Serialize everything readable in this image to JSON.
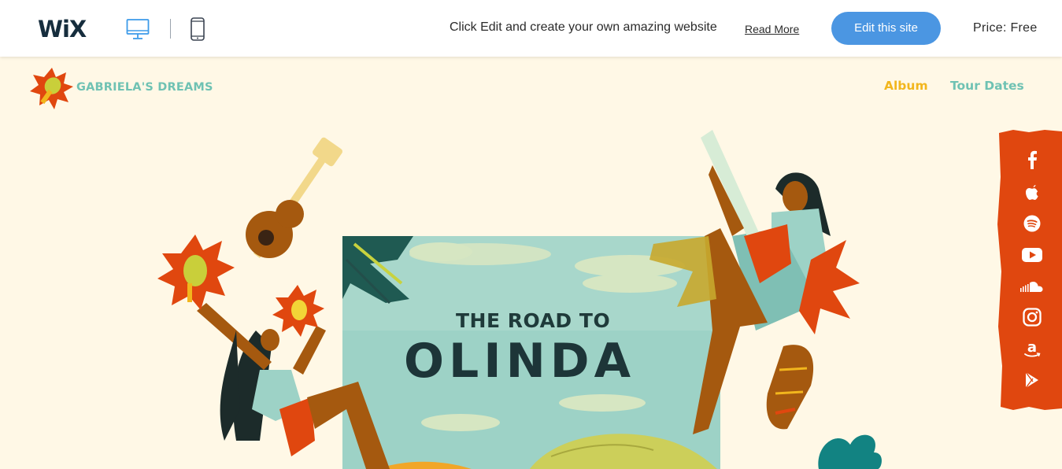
{
  "wix_bar": {
    "logo": "WiX",
    "promo_text": "Click Edit and create your own amazing website",
    "read_more": "Read More",
    "edit_button": "Edit this site",
    "price": "Price: Free",
    "devices": [
      "desktop-icon",
      "mobile-icon"
    ]
  },
  "site": {
    "name": "GABRIELA'S DREAMS",
    "nav": [
      "Album",
      "Tour Dates"
    ],
    "album_cover": {
      "title_line_1": "THE ROAD TO",
      "title_line_2": "OLINDA"
    },
    "social_links": [
      "facebook-icon",
      "apple-music-icon",
      "spotify-icon",
      "youtube-icon",
      "soundcloud-icon",
      "instagram-icon",
      "amazon-icon",
      "google-play-icon"
    ]
  },
  "colors": {
    "background": "#fff8e6",
    "edit_button": "#4b96e2",
    "brand_teal": "#6fc2b3",
    "accent_yellow": "#f2b61d",
    "social_bar": "#e0470f"
  }
}
